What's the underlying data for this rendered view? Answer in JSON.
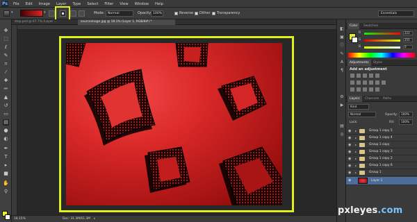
{
  "app": {
    "logo": "Ps"
  },
  "menu": [
    "File",
    "Edit",
    "Image",
    "Layer",
    "Type",
    "Select",
    "Filter",
    "View",
    "Window",
    "Help"
  ],
  "options": {
    "mode_label": "Mode:",
    "mode_value": "Normal",
    "opacity_label": "Opacity:",
    "opacity_value": "100%",
    "reverse_label": "Reverse",
    "dither_label": "Dither",
    "transparency_label": "Transparency",
    "workspace": "Essentials",
    "selected_gradient_type": "diamond gradient",
    "highlight_color": "#e3f21f"
  },
  "tabs": [
    {
      "label": "step.psd @ 67.7% (Layer ..."
    },
    {
      "label": "sourceimage.jpg @ 18.1% (Layer 1, RGB/8#) *"
    }
  ],
  "status": {
    "zoom": "18.15%",
    "doc": "Doc: 31.3M/61.3M"
  },
  "color_panel": {
    "tabs": [
      "Color",
      "Swatches"
    ],
    "r": {
      "label": "R",
      "value": "222"
    },
    "g": {
      "label": "G",
      "value": "255"
    },
    "b": {
      "label": "B",
      "value": "0"
    },
    "foreground": "#e6f21f"
  },
  "adjustments": {
    "tabs": [
      "Adjustments",
      "Styles"
    ],
    "title": "Add an adjustment"
  },
  "layers_panel": {
    "tabs": [
      "Layers",
      "Channels",
      "Paths"
    ],
    "kind": "Kind",
    "blend": "Normal",
    "opacity_label": "Opacity:",
    "opacity_value": "100%",
    "lock_label": "Lock:",
    "fill_label": "Fill:",
    "fill_value": "100%",
    "layers": [
      {
        "name": "Group 1 copy 5",
        "type": "group"
      },
      {
        "name": "Group 1 copy 4",
        "type": "group"
      },
      {
        "name": "Group 1 copy",
        "type": "group"
      },
      {
        "name": "Group 1 copy 3",
        "type": "group"
      },
      {
        "name": "Group 1 copy 2",
        "type": "group"
      },
      {
        "name": "Group 1 copy 6",
        "type": "group"
      },
      {
        "name": "Group 1",
        "type": "group"
      },
      {
        "name": "Layer 1",
        "type": "layer"
      }
    ]
  },
  "watermark": {
    "text": "pxleyes",
    "suffix": ".com"
  }
}
